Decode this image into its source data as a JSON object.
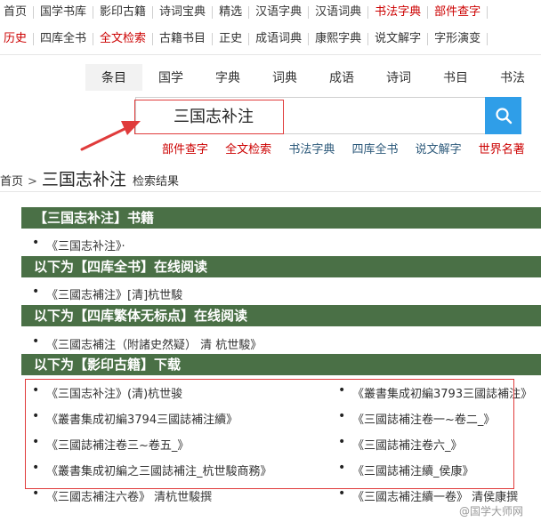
{
  "nav": {
    "row1": [
      {
        "label": "首页",
        "red": false
      },
      {
        "label": "国学书库",
        "red": false
      },
      {
        "label": "影印古籍",
        "red": false
      },
      {
        "label": "诗词宝典",
        "red": false
      },
      {
        "label": "精选",
        "red": false
      },
      {
        "label": "汉语字典",
        "red": false
      },
      {
        "label": "汉语词典",
        "red": false
      },
      {
        "label": "书法字典",
        "red": true
      },
      {
        "label": "部件查字",
        "red": true
      }
    ],
    "row2": [
      {
        "label": "历史",
        "red": true
      },
      {
        "label": "四库全书",
        "red": false
      },
      {
        "label": "全文检索",
        "red": true
      },
      {
        "label": "古籍书目",
        "red": false
      },
      {
        "label": "正史",
        "red": false
      },
      {
        "label": "成语词典",
        "red": false
      },
      {
        "label": "康熙字典",
        "red": false
      },
      {
        "label": "说文解字",
        "red": false
      },
      {
        "label": "字形演变",
        "red": false
      }
    ]
  },
  "tabs": [
    "条目",
    "国学",
    "字典",
    "词典",
    "成语",
    "诗词",
    "书目",
    "书法"
  ],
  "search": {
    "value": "三国志补注"
  },
  "sublinks": [
    {
      "label": "部件查字",
      "red": true
    },
    {
      "label": "全文检索",
      "red": true
    },
    {
      "label": "书法字典",
      "red": false
    },
    {
      "label": "四库全书",
      "red": false
    },
    {
      "label": "说文解字",
      "red": false
    },
    {
      "label": "世界名著",
      "red": true
    }
  ],
  "breadcrumb": {
    "home": "首页",
    "sep": ">",
    "term": "三国志补注",
    "result": "检索结果"
  },
  "sections": [
    {
      "title": "【三国志补注】书籍",
      "items": [
        "《三国志补注》·"
      ]
    },
    {
      "title": "以下为【四库全书】在线阅读",
      "items": [
        "《三國志補注》[清]杭世駿"
      ]
    },
    {
      "title": "以下为【四库繁体无标点】在线阅读",
      "items": [
        "《三國志補注（附諸史然疑） 清 杭世駿》"
      ]
    },
    {
      "title": "以下为【影印古籍】下载",
      "items": []
    }
  ],
  "downloads_left": [
    "《三国志补注》(清)杭世骏",
    "《叢書集成初編3794三國誌補注續》",
    "《三國誌補注卷三~卷五_》",
    "《叢書集成初編之三國誌補注_杭世駿商務》",
    "《三國志補注六卷》 清杭世駿撰"
  ],
  "downloads_right": [
    "《叢書集成初編3793三國誌補注》",
    "《三國誌補注卷一~卷二_》",
    "《三國誌補注卷六_》",
    "《三國誌補注續_侯康》",
    "《三國志補注續一卷》 清侯康撰"
  ],
  "watermark": "@国学大师网",
  "colors": {
    "section_bg": "#4a7046",
    "accent_red": "#cc0000",
    "search_btn": "#2f9ee8"
  }
}
